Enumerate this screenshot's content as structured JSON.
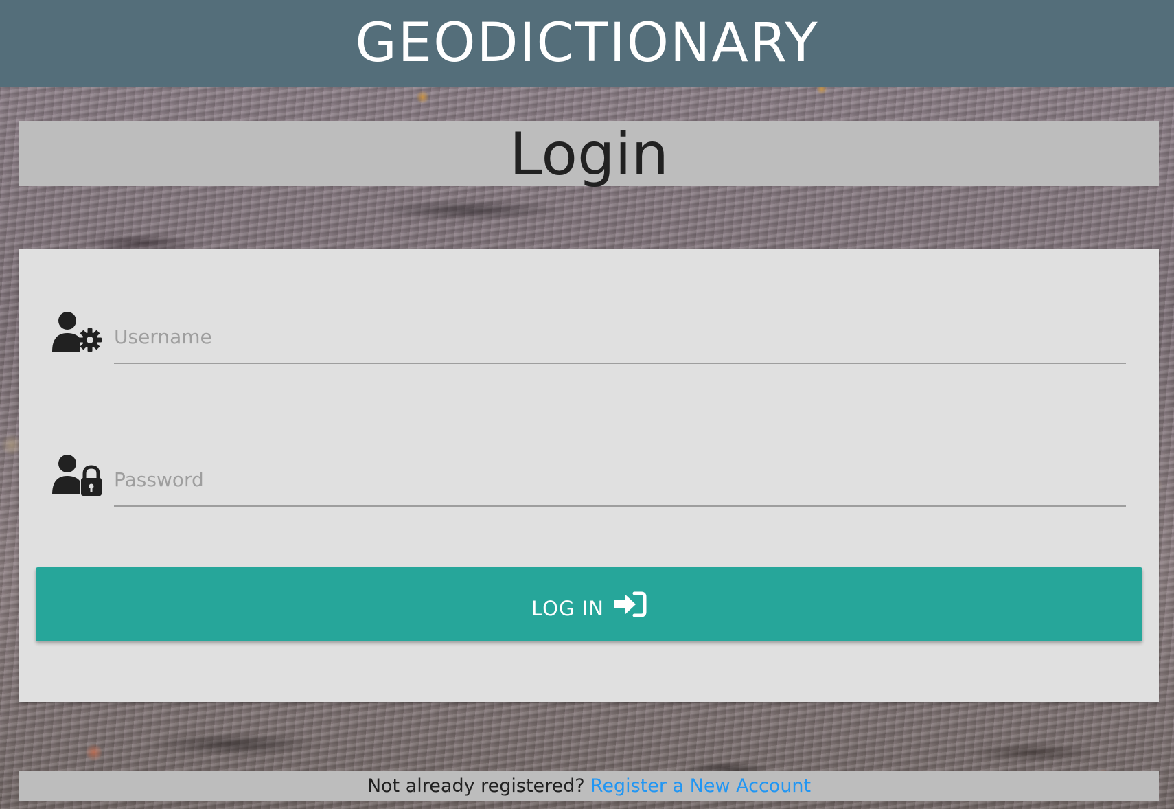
{
  "header": {
    "brand": "GEODICTIONARY"
  },
  "page": {
    "title": "Login"
  },
  "form": {
    "username": {
      "placeholder": "Username",
      "value": "",
      "icon": "user-cog-icon"
    },
    "password": {
      "placeholder": "Password",
      "value": "",
      "icon": "user-lock-icon"
    },
    "submit": {
      "label": "LOG IN",
      "icon": "sign-in-icon"
    }
  },
  "footer": {
    "prompt": "Not already registered?",
    "register_link": "Register a New Account"
  },
  "colors": {
    "header_bg": "#546e7a",
    "panel_bg": "#bdbdbd",
    "card_bg": "#e0e0e0",
    "button_bg": "#26a69a",
    "link": "#2196f3"
  }
}
